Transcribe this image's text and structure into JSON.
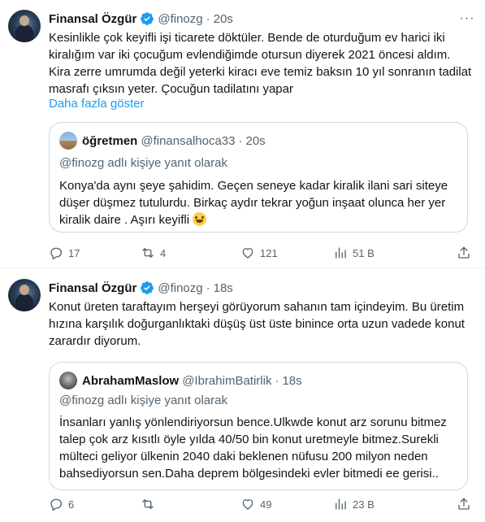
{
  "tweets": [
    {
      "author_name": "Finansal Özgür",
      "handle": "@finozg",
      "time": "20s",
      "text": "Kesinlikle çok keyifli işi ticarete döktüler. Bende de oturduğum ev harici iki kiralığım var iki çocuğum evlendiğimde otursun diyerek 2021 öncesi aldım. Kira zerre umrumda değil yeterki kiracı eve temiz baksın 10 yıl sonranın tadilat masrafı çıksın yeter. Çocuğun tadilatını yapar",
      "show_more": "Daha fazla göster",
      "quote": {
        "author_name": "öğretmen",
        "handle": "@finansalhoca33",
        "time": "20s",
        "reply_to": "@finozg adlı kişiye yanıt olarak",
        "text": "Konya'da aynı şeye şahidim. Geçen seneye kadar kiralik ilani sari siteye düşer düşmez tutulurdu. Birkaç aydır tekrar yoğun inşaat olunca her yer kiralik daire . Aşırı keyifli"
      },
      "stats": {
        "replies": "17",
        "retweets": "4",
        "likes": "121",
        "views": "51 B"
      }
    },
    {
      "author_name": "Finansal Özgür",
      "handle": "@finozg",
      "time": "18s",
      "text": "Konut üreten taraftayım herşeyi görüyorum sahanın tam içindeyim. Bu üretim hızına karşılık doğurganlıktaki düşüş üst üste binince orta uzun vadede konut zarardır diyorum.",
      "quote": {
        "author_name": "AbrahamMaslow",
        "handle": "@IbrahimBatirlik",
        "time": "18s",
        "reply_to": "@finozg adlı kişiye yanıt olarak",
        "text": "İnsanları yanlış yönlendiriyorsun bence.Ulkwde konut arz sorunu bitmez talep çok arz kısıtlı öyle yılda 40/50 bin konut uretmeyle bitmez.Surekli mülteci geliyor ülkenin 2040 daki beklenen nüfusu 200 milyon neden bahsediyorsun sen.Daha deprem bölgesindeki evler bitmedi ee gerisi.."
      },
      "stats": {
        "replies": "6",
        "retweets": "",
        "likes": "49",
        "views": "23 B"
      }
    }
  ],
  "dot_separator": "·",
  "colors": {
    "accent": "#1d9bf0",
    "muted": "#536471",
    "text": "#0f1419",
    "border": "#cfd9de"
  },
  "icons": [
    "verified-badge-icon",
    "more-options-icon",
    "reply-icon",
    "retweet-icon",
    "like-icon",
    "views-icon",
    "share-icon",
    "grinning-sweat-emoji"
  ]
}
